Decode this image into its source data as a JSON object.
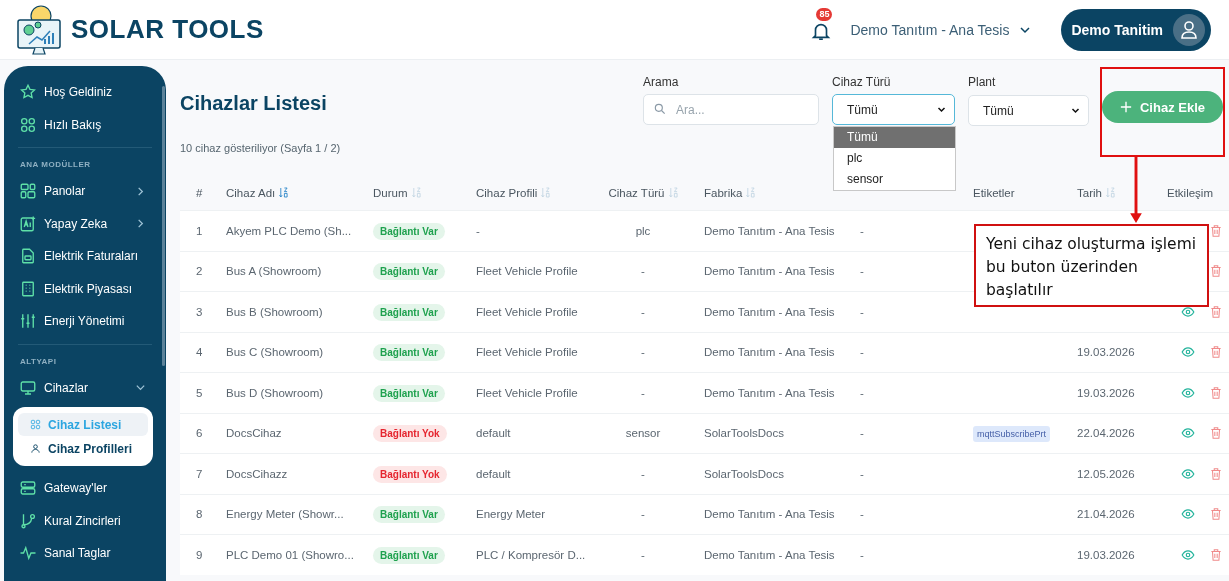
{
  "header": {
    "brand": "SOLAR TOOLS",
    "notification_count": "85",
    "plant_selector": "Demo Tanıtım - Ana Tesis",
    "user": "Demo Tanitim"
  },
  "sidebar": {
    "groups": [
      {
        "items": [
          {
            "label": "Hoş Geldiniz"
          },
          {
            "label": "Hızlı Bakış"
          }
        ]
      },
      {
        "heading": "ANA MODÜLLER",
        "items": [
          {
            "label": "Panolar",
            "expanded": false
          },
          {
            "label": "Yapay Zeka",
            "expanded": false
          },
          {
            "label": "Elektrik Faturaları"
          },
          {
            "label": "Elektrik Piyasası"
          },
          {
            "label": "Enerji Yönetimi"
          }
        ]
      },
      {
        "heading": "ALTYAPI",
        "items": [
          {
            "label": "Cihazlar",
            "expanded": true,
            "children": [
              {
                "label": "Cihaz Listesi",
                "selected": true
              },
              {
                "label": "Cihaz Profilleri",
                "selected": false
              }
            ]
          },
          {
            "label": "Gateway'ler"
          },
          {
            "label": "Kural Zincirleri"
          },
          {
            "label": "Sanal Taglar"
          }
        ]
      }
    ]
  },
  "page": {
    "title": "Cihazlar Listesi",
    "count_text": "10 cihaz gösteriliyor (Sayfa 1 / 2)"
  },
  "filters": {
    "search": {
      "label": "Arama",
      "placeholder": "Ara..."
    },
    "type_filter": {
      "label": "Cihaz Türü",
      "value": "Tümü",
      "open": true,
      "options": [
        {
          "label": "Tümü",
          "selected": true
        },
        {
          "label": "plc",
          "selected": false
        },
        {
          "label": "sensor",
          "selected": false
        }
      ]
    },
    "plant_filter": {
      "label": "Plant",
      "value": "Tümü"
    },
    "add_button": "Cihaz Ekle"
  },
  "table": {
    "columns": [
      {
        "label": "#",
        "sortable": false
      },
      {
        "label": "Cihaz Adı",
        "sortable": true,
        "sort_active": true
      },
      {
        "label": "Durum",
        "sortable": true,
        "sort_active": false
      },
      {
        "label": "Cihaz Profili",
        "sortable": true,
        "sort_active": false
      },
      {
        "label": "Cihaz Türü",
        "sortable": true,
        "sort_active": false
      },
      {
        "label": "Fabrika",
        "sortable": true,
        "sort_active": false
      },
      {
        "label": "Etiketler",
        "sortable": false
      },
      {
        "label": "Tarih",
        "sortable": true,
        "sort_active": false
      },
      {
        "label": "Etkileşim",
        "sortable": false
      }
    ],
    "rows": [
      {
        "index": "1",
        "name": "Akyem PLC Demo (Sh...",
        "status": "Bağlantı Var",
        "connected": true,
        "profile": "-",
        "type": "plc",
        "plant": "Demo Tanıtım - Ana Tesis",
        "column_7": "-"
      },
      {
        "index": "2",
        "name": "Bus A (Showroom)",
        "status": "Bağlantı Var",
        "connected": true,
        "profile": "Fleet Vehicle Profile",
        "type": "-",
        "plant": "Demo Tanıtım - Ana Tesis",
        "column_7": "-"
      },
      {
        "index": "3",
        "name": "Bus B (Showroom)",
        "status": "Bağlantı Var",
        "connected": true,
        "profile": "Fleet Vehicle Profile",
        "type": "-",
        "plant": "Demo Tanıtım - Ana Tesis",
        "column_7": "-"
      },
      {
        "index": "4",
        "name": "Bus C (Showroom)",
        "status": "Bağlantı Var",
        "connected": true,
        "profile": "Fleet Vehicle Profile",
        "type": "-",
        "plant": "Demo Tanıtım - Ana Tesis",
        "column_7": "-",
        "date": "19.03.2026"
      },
      {
        "index": "5",
        "name": "Bus D (Showroom)",
        "status": "Bağlantı Var",
        "connected": true,
        "profile": "Fleet Vehicle Profile",
        "type": "-",
        "plant": "Demo Tanıtım - Ana Tesis",
        "column_7": "-",
        "date": "19.03.2026"
      },
      {
        "index": "6",
        "name": "DocsCihaz",
        "status": "Bağlantı Yok",
        "connected": false,
        "profile": "default",
        "type": "sensor",
        "plant": "SolarToolsDocs",
        "column_7": "-",
        "tags": [
          "mqttSubscribePrt"
        ],
        "date": "22.04.2026"
      },
      {
        "index": "7",
        "name": "DocsCihazz",
        "status": "Bağlantı Yok",
        "connected": false,
        "profile": "default",
        "type": "-",
        "plant": "SolarToolsDocs",
        "column_7": "-",
        "date": "12.05.2026"
      },
      {
        "index": "8",
        "name": "Energy Meter (Showr...",
        "status": "Bağlantı Var",
        "connected": true,
        "profile": "Energy Meter",
        "type": "-",
        "plant": "Demo Tanıtım - Ana Tesis",
        "column_7": "-",
        "date": "21.04.2026"
      },
      {
        "index": "9",
        "name": "PLC Demo 01 (Showro...",
        "status": "Bağlantı Var",
        "connected": true,
        "profile": "PLC / Kompresör D...",
        "type": "-",
        "plant": "Demo Tanıtım - Ana Tesis",
        "column_7": "-",
        "date": "19.03.2026"
      }
    ]
  },
  "annotation": {
    "text": "Yeni cihaz oluşturma işlemi bu buton üzerinden başlatılır"
  }
}
